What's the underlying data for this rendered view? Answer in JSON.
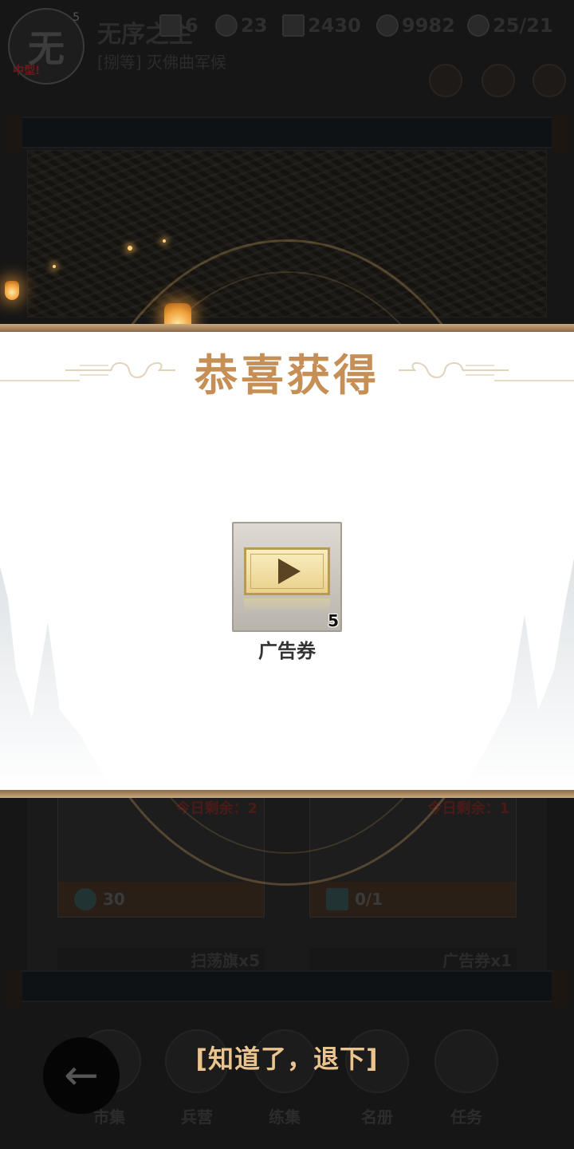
{
  "player": {
    "avatar_glyph": "无",
    "level": "5",
    "avatar_tag": "中型!",
    "name": "无序之主",
    "title": "[捌等] 灭佛曲军候"
  },
  "resources": [
    {
      "icon": "ad-ticket-icon",
      "value": "6"
    },
    {
      "icon": "jade-coin-icon",
      "value": "23"
    },
    {
      "icon": "granary-icon",
      "value": "2430"
    },
    {
      "icon": "copper-coin-icon",
      "value": "9982"
    },
    {
      "icon": "wheat-icon",
      "value": "25/21"
    }
  ],
  "background_cards": [
    {
      "remain": "今日剩余：2",
      "cost": "30",
      "cost_icon": "jade-coin-icon"
    },
    {
      "remain": "今日剩余：1",
      "cost": "0/1",
      "cost_icon": "ad-ticket-icon"
    }
  ],
  "background_mini_cards": [
    "扫荡旗x5",
    "广告券x1"
  ],
  "nav": {
    "items": [
      {
        "label": "市集",
        "icon": "market-icon"
      },
      {
        "label": "兵营",
        "icon": "barracks-icon"
      },
      {
        "label": "练集",
        "icon": "training-icon"
      },
      {
        "label": "名册",
        "icon": "roster-icon"
      },
      {
        "label": "任务",
        "icon": "quest-icon"
      }
    ]
  },
  "modal": {
    "title": "恭喜获得",
    "reward": {
      "name": "广告券",
      "count": "5",
      "icon": "ad-ticket-icon"
    },
    "dismiss_label": "[知道了，退下]"
  },
  "colors": {
    "title_gold": "#c58f55",
    "border_bronze": "#8b6a45",
    "dismiss_gold": "#e9c48e"
  }
}
